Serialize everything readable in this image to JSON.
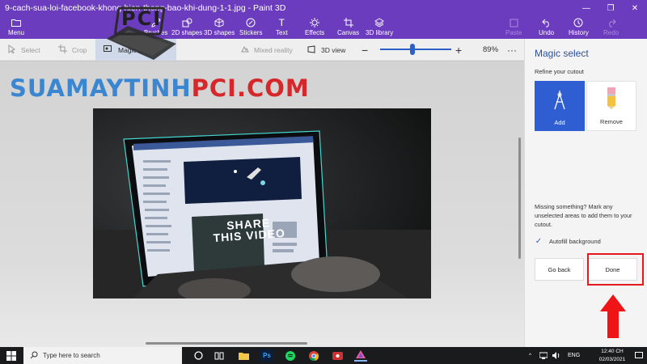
{
  "window": {
    "title": "9-cach-sua-loi-facebook-khong-hien-thong-bao-khi-dung-1-1.jpg - Paint 3D"
  },
  "ribbon": {
    "menu": "Menu",
    "brushes": "Brushes",
    "shapes2d": "2D shapes",
    "shapes3d": "3D shapes",
    "stickers": "Stickers",
    "text": "Text",
    "effects": "Effects",
    "canvas": "Canvas",
    "library3d": "3D library",
    "paste": "Paste",
    "undo": "Undo",
    "history": "History",
    "redo": "Redo"
  },
  "toolbar": {
    "select": "Select",
    "crop": "Crop",
    "magic_select": "Magic select",
    "mixed_reality": "Mixed reality",
    "view3d": "3D view",
    "zoom_value": "89%",
    "zoom_fraction": 0.45
  },
  "watermark": {
    "part1": "SUAMAYTINH",
    "part2": "PCI.COM",
    "logo_text": "PCI"
  },
  "photo": {
    "headline_line1": "SHARE",
    "headline_line2": "THIS VIDEO"
  },
  "panel": {
    "title": "Magic select",
    "subtitle": "Refine your cutout",
    "add_label": "Add",
    "remove_label": "Remove",
    "hint": "Missing something? Mark any unselected areas to add them to your cutout.",
    "autofill_label": "Autofill background",
    "autofill_checked": true,
    "go_back": "Go back",
    "done": "Done"
  },
  "taskbar": {
    "search_placeholder": "Type here to search",
    "language": "ENG",
    "time": "12:40 CH",
    "date": "02/03/2021"
  },
  "colors": {
    "accent": "#6b3cbd",
    "selection_blue": "#2f5ed2",
    "highlight_red": "#e3191d"
  }
}
